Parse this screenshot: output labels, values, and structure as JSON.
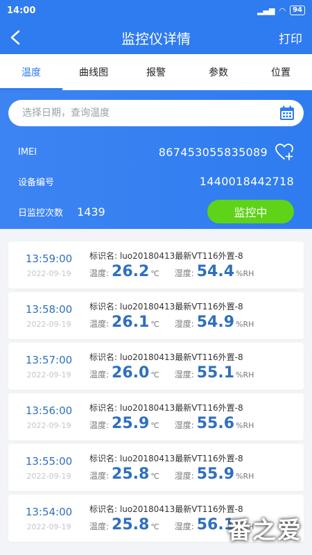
{
  "status": {
    "time": "14:00",
    "battery": "94"
  },
  "header": {
    "title": "监控仪详情",
    "print": "打印"
  },
  "tabs": [
    {
      "label": "温度",
      "active": true
    },
    {
      "label": "曲线图"
    },
    {
      "label": "报警"
    },
    {
      "label": "参数"
    },
    {
      "label": "位置"
    }
  ],
  "search": {
    "placeholder": "选择日期，查询温度"
  },
  "device": {
    "imei_label": "IMEI",
    "imei": "867453055835089",
    "id_label": "设备编号",
    "id": "1440018442718",
    "daily_label": "日监控次数",
    "daily_count": "1439",
    "status_button": "监控中"
  },
  "labels": {
    "name_prefix": "标识名: ",
    "temp": "温度:",
    "temp_unit": "℃",
    "hum": "湿度:",
    "hum_unit": "%RH"
  },
  "records": [
    {
      "time": "13:59:00",
      "date": "2022-09-19",
      "name": "luo20180413最新VT116外置-8",
      "temp": "26.2",
      "hum": "54.4"
    },
    {
      "time": "13:58:00",
      "date": "2022-09-19",
      "name": "luo20180413最新VT116外置-8",
      "temp": "26.1",
      "hum": "54.9"
    },
    {
      "time": "13:57:00",
      "date": "2022-09-19",
      "name": "luo20180413最新VT116外置-8",
      "temp": "26.0",
      "hum": "55.1"
    },
    {
      "time": "13:56:00",
      "date": "2022-09-19",
      "name": "luo20180413最新VT116外置-8",
      "temp": "25.9",
      "hum": "55.6"
    },
    {
      "time": "13:55:00",
      "date": "2022-09-19",
      "name": "luo20180413最新VT116外置-8",
      "temp": "25.8",
      "hum": "55.9"
    },
    {
      "time": "13:54:00",
      "date": "2022-09-19",
      "name": "luo20180413最新VT116外置-8",
      "temp": "25.8",
      "hum": "56.1"
    }
  ],
  "watermark": "番之爱",
  "colors": {
    "primary": "#2f7bf0",
    "accent_green": "#5ed317"
  }
}
